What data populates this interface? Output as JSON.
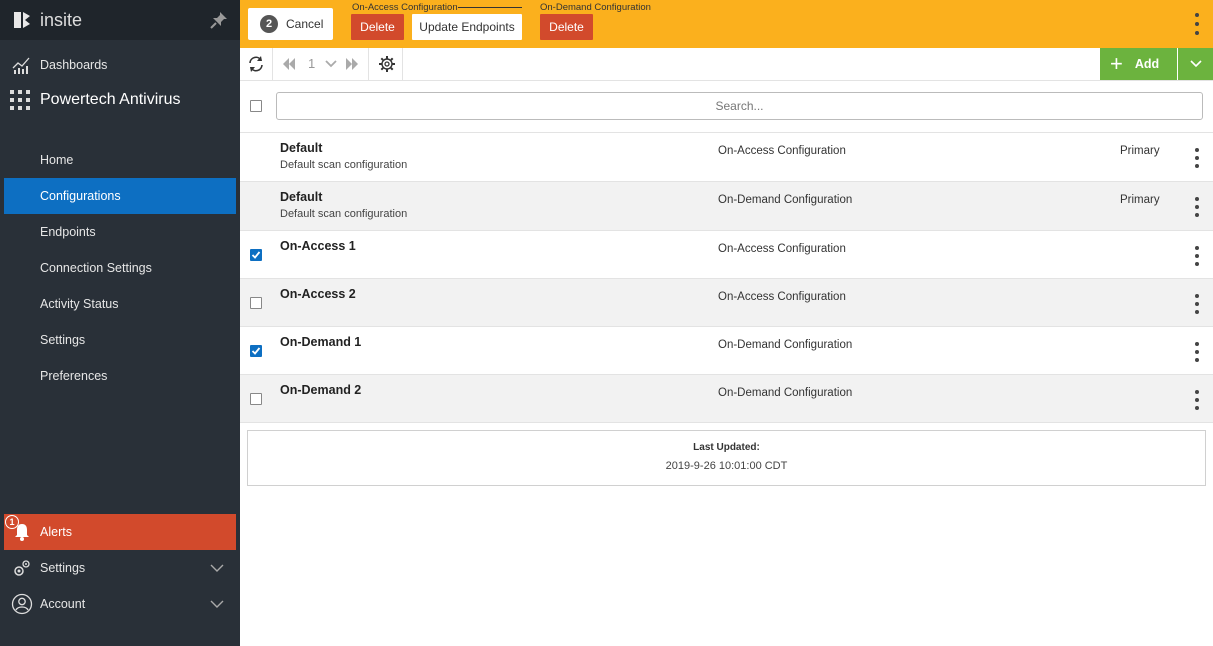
{
  "sidebar": {
    "brand": "insite",
    "dashboards_label": "Dashboards",
    "app_label": "Powertech Antivirus",
    "nav": {
      "home": "Home",
      "configurations": "Configurations",
      "endpoints": "Endpoints",
      "connection_settings": "Connection Settings",
      "activity_status": "Activity Status",
      "settings": "Settings",
      "preferences": "Preferences"
    },
    "alerts_label": "Alerts",
    "alerts_count": "1",
    "bottom_settings_label": "Settings",
    "account_label": "Account"
  },
  "topbar": {
    "selected_count": "2",
    "cancel_label": "Cancel",
    "on_access_group_label": "On-Access Configuration",
    "on_demand_group_label": "On-Demand Configuration",
    "delete_label": "Delete",
    "update_endpoints_label": "Update Endpoints",
    "accent_color": "#fbb01d"
  },
  "toolbar": {
    "page_number": "1",
    "add_label": "Add"
  },
  "search": {
    "placeholder": "Search..."
  },
  "rows": [
    {
      "name": "Default",
      "desc": "Default scan configuration",
      "type": "On-Access Configuration",
      "primary": "Primary",
      "checked": null
    },
    {
      "name": "Default",
      "desc": "Default scan configuration",
      "type": "On-Demand Configuration",
      "primary": "Primary",
      "checked": null
    },
    {
      "name": "On-Access 1",
      "desc": "",
      "type": "On-Access Configuration",
      "primary": "",
      "checked": true
    },
    {
      "name": "On-Access 2",
      "desc": "",
      "type": "On-Access Configuration",
      "primary": "",
      "checked": false
    },
    {
      "name": "On-Demand 1",
      "desc": "",
      "type": "On-Demand Configuration",
      "primary": "",
      "checked": true
    },
    {
      "name": "On-Demand 2",
      "desc": "",
      "type": "On-Demand Configuration",
      "primary": "",
      "checked": false
    }
  ],
  "last_updated": {
    "label": "Last Updated:",
    "value": "2019-9-26 10:01:00 CDT"
  }
}
